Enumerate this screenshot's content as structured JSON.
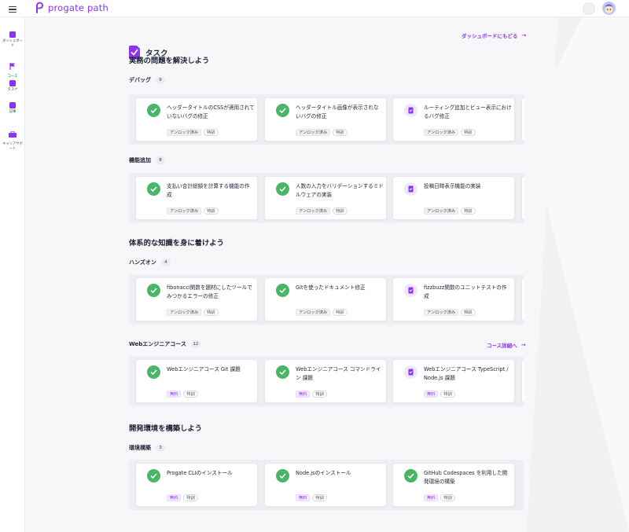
{
  "app": {
    "brand": "progate path"
  },
  "sidebar": {
    "items": [
      {
        "label": "ダッシュボード",
        "icon": "dashboard-icon"
      },
      {
        "label": "コース",
        "icon": "flag-icon"
      },
      {
        "label": "タスク",
        "icon": "task-icon"
      },
      {
        "label": "記事",
        "icon": "article-icon"
      },
      {
        "label": "キャリアサポート",
        "icon": "briefcase-icon"
      }
    ]
  },
  "page": {
    "title": "タスク",
    "dashboard_link": "ダッシュボードにもどる",
    "arrow": "→"
  },
  "sections": [
    {
      "title": "実務の問題を解決しよう"
    },
    {
      "title": "体系的な知識を身に着けよう"
    },
    {
      "title": "開発環境を構築しよう"
    }
  ],
  "groups": [
    {
      "name": "デバッグ",
      "count": "9",
      "cards": [
        {
          "title": "ヘッダータイトルのCSSが適用されていないバグの修正",
          "status": "done",
          "tags": [
            "アンロック済み",
            "特訓"
          ]
        },
        {
          "title": "ヘッダータイトル画像が表示されないバグの修正",
          "status": "done",
          "tags": [
            "アンロック済み",
            "特訓"
          ]
        },
        {
          "title": "ルーティング追加とビュー表示におけるバグ修正",
          "status": "todo",
          "tags": [
            "アンロック済み",
            "特訓"
          ]
        }
      ]
    },
    {
      "name": "機能追加",
      "count": "8",
      "cards": [
        {
          "title": "支払い合計総額を計算する機能の作成",
          "status": "done",
          "tags": [
            "アンロック済み",
            "特訓"
          ]
        },
        {
          "title": "人数の入力をバリデーションするミドルウェアの実装",
          "status": "done",
          "tags": [
            "アンロック済み",
            "特訓"
          ]
        },
        {
          "title": "投稿日時表示機能の実装",
          "status": "todo",
          "tags": [
            "アンロック済み",
            "特訓"
          ]
        }
      ]
    },
    {
      "name": "ハンズオン",
      "count": "4",
      "cards": [
        {
          "title": "fibonacci関数を題材にしたツールでみつかるエラーの修正",
          "status": "done",
          "tags": [
            "アンロック済み",
            "特訓"
          ]
        },
        {
          "title": "Gitを使ったドキュメント修正",
          "status": "done",
          "tags": [
            "アンロック済み",
            "特訓"
          ]
        },
        {
          "title": "fizzbuzz関数のユニットテストの作成",
          "status": "todo",
          "tags": [
            "アンロック済み",
            "特訓"
          ]
        }
      ]
    },
    {
      "name": "Webエンジニアコース",
      "count": "12",
      "link": "コース詳細へ",
      "cards": [
        {
          "title": "Webエンジニアコース Git 課題",
          "status": "done",
          "tags": [
            "無料",
            "特訓"
          ]
        },
        {
          "title": "Webエンジニアコース コマンドライン 課題",
          "status": "done",
          "tags": [
            "無料",
            "特訓"
          ]
        },
        {
          "title": "Webエンジニアコース TypeScript / Node.js 課題",
          "status": "todo",
          "tags": [
            "無料",
            "特訓"
          ]
        }
      ]
    },
    {
      "name": "環境構築",
      "count": "3",
      "cards": [
        {
          "title": "Progate CLIのインストール",
          "status": "done",
          "tags": [
            "無料",
            "特訓"
          ]
        },
        {
          "title": "Node.jsのインストール",
          "status": "done",
          "tags": [
            "無料",
            "特訓"
          ]
        },
        {
          "title": "GitHub Codespaces を利用した開発環境の構築",
          "status": "done",
          "tags": [
            "無料",
            "特訓"
          ]
        }
      ]
    }
  ],
  "colors": {
    "accent": "#8a35f0",
    "done": "#49b667",
    "text": "#1f2235"
  }
}
